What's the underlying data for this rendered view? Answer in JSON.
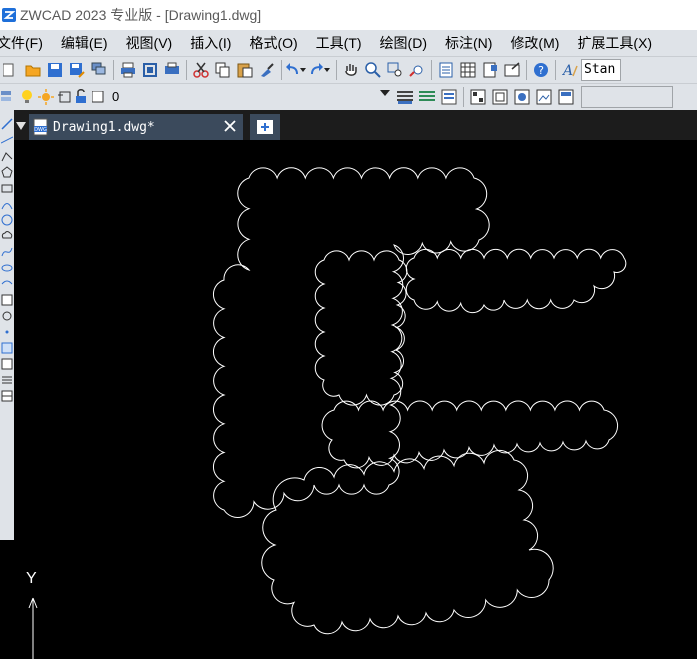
{
  "window": {
    "title": "ZWCAD 2023 专业版 - [Drawing1.dwg]"
  },
  "menu": [
    "文件(F)",
    "编辑(E)",
    "视图(V)",
    "插入(I)",
    "格式(O)",
    "工具(T)",
    "绘图(D)",
    "标注(N)",
    "修改(M)",
    "扩展工具(X)"
  ],
  "toolbar": {
    "icons": [
      "new-icon",
      "open-icon",
      "save-icon",
      "save-as-icon",
      "layers-manager-icon",
      "print-icon",
      "zoom-extents-icon",
      "plot-preview-icon",
      "cut-icon",
      "copy-icon",
      "paste-icon",
      "match-properties-icon",
      "undo-icon",
      "redo-icon",
      "pan-icon",
      "zoom-realtime-icon",
      "zoom-window-icon",
      "zoom-previous-icon",
      "properties-icon",
      "design-center-icon",
      "tool-palettes-icon",
      "sheet-set-icon",
      "help-icon",
      "text-style-icon"
    ],
    "text_style_value": "Stan"
  },
  "layer_bar": {
    "current_layer": "0",
    "icons": [
      "light-bulb-icon",
      "sun-freeze-icon",
      "layer-lock-icon",
      "lock-unlocked-icon",
      "color-swatch-icon"
    ]
  },
  "document_tabs": {
    "active": "Drawing1.dwg*"
  },
  "canvas": {
    "background": "#000000",
    "stroke": "#ffffff",
    "ucs_label": "Y"
  },
  "colors": {
    "title_bg": "#ffffff",
    "menu_bg": "#dfe3e8",
    "tab_active": "#3b4a5c",
    "accent_blue": "#1e88e5"
  }
}
